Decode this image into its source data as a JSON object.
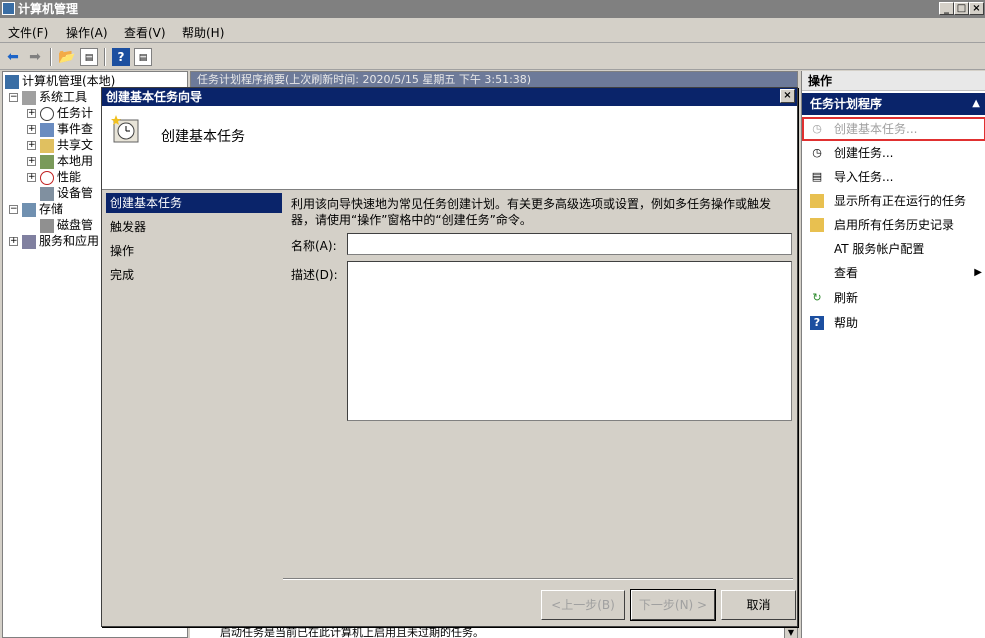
{
  "window": {
    "title": "计算机管理",
    "min": "_",
    "max": "□",
    "close": "×"
  },
  "menu": {
    "items": [
      "文件(F)",
      "操作(A)",
      "查看(V)",
      "帮助(H)"
    ]
  },
  "tree": {
    "root": "计算机管理(本地)",
    "system_tools": "系统工具",
    "task_scheduler": "任务计",
    "event_viewer": "事件查",
    "shared_folders": "共享文",
    "local_users": "本地用",
    "performance": "性能",
    "device_manager": "设备管",
    "storage": "存储",
    "disk_management": "磁盘管",
    "services_apps": "服务和应用"
  },
  "center": {
    "header": "任务计划程序摘要(上次刷新时间: 2020/5/15 星期五 下午 3:51:38)",
    "bottom_text": "启动任务是当前已在此计算机上启用且未过期的任务。"
  },
  "actions": {
    "title": "操作",
    "section": "任务计划程序",
    "items": [
      {
        "label": "创建基本任务...",
        "icon": "clock-star-icon"
      },
      {
        "label": "创建任务...",
        "icon": "clock-icon"
      },
      {
        "label": "导入任务...",
        "icon": "import-icon"
      },
      {
        "label": "显示所有正在运行的任务",
        "icon": "folder-icon"
      },
      {
        "label": "启用所有任务历史记录",
        "icon": "folder-icon"
      },
      {
        "label": "AT 服务帐户配置",
        "icon": ""
      },
      {
        "label": "查看",
        "icon": ""
      },
      {
        "label": "刷新",
        "icon": "refresh-icon"
      },
      {
        "label": "帮助",
        "icon": "help-icon"
      }
    ]
  },
  "dialog": {
    "title": "创建基本任务向导",
    "close": "×",
    "banner_title": "创建基本任务",
    "steps": [
      "创建基本任务",
      "触发器",
      "操作",
      "完成"
    ],
    "description_line1": "利用该向导快速地为常见任务创建计划。有关更多高级选项或设置，例如多任务操作或触发",
    "description_line2": "器，请使用“操作”窗格中的“创建任务”命令。",
    "name_label": "名称(A):",
    "name_value": "",
    "desc_label": "描述(D):",
    "desc_value": "",
    "back_button": "<上一步(B)",
    "next_button": "下一步(N) >",
    "cancel_button": "取消"
  },
  "colors": {
    "title_active": "#0a246a",
    "highlight_outline": "#e03030",
    "chrome": "#d4d0c8"
  }
}
